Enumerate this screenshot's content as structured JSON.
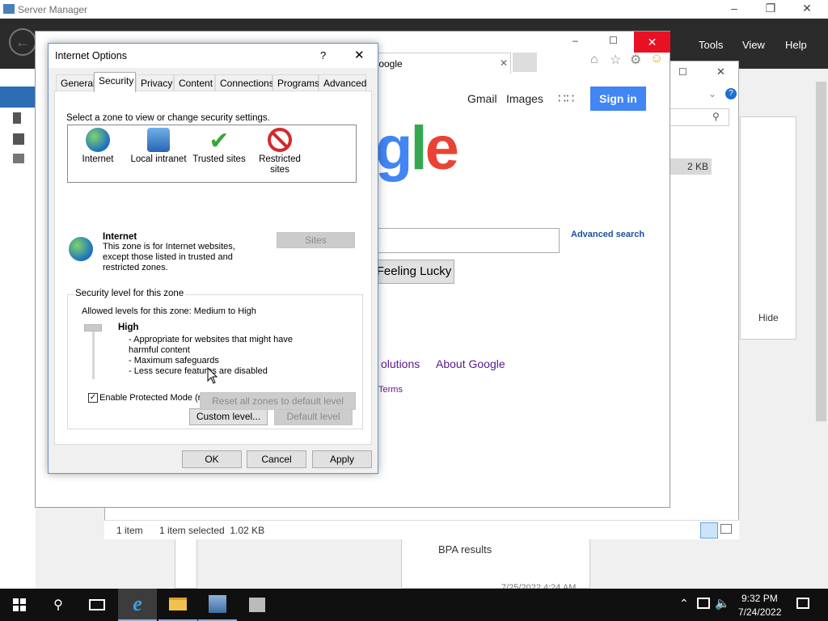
{
  "server_manager": {
    "title": "Server Manager",
    "menu": [
      "Tools",
      "View",
      "Help"
    ],
    "bpa": "BPA results",
    "date": "7/25/2022 4:24 AM"
  },
  "explorer": {
    "item_count": "1 item",
    "selection": "1 item selected  1.02 KB",
    "file_size": "2 KB",
    "hide": "Hide"
  },
  "ie": {
    "tab_title": "Google",
    "google": {
      "links": [
        "Gmail",
        "Images"
      ],
      "sign_in": "Sign in",
      "advanced_search": "Advanced search",
      "lucky": "Feeling Lucky",
      "footer": [
        "olutions",
        "About Google"
      ],
      "terms": "Terms"
    }
  },
  "dialog": {
    "title": "Internet Options",
    "help": "?",
    "tabs": [
      "General",
      "Security",
      "Privacy",
      "Content",
      "Connections",
      "Programs",
      "Advanced"
    ],
    "zone_prompt": "Select a zone to view or change security settings.",
    "zones": [
      {
        "label": "Internet"
      },
      {
        "label": "Local intranet"
      },
      {
        "label": "Trusted sites"
      },
      {
        "label": "Restricted sites"
      }
    ],
    "zone_name": "Internet",
    "zone_desc": "This zone is for Internet websites, except those listed in trusted and restricted zones.",
    "sites": "Sites",
    "security_group": "Security level for this zone",
    "allowed": "Allowed levels for this zone: Medium to High",
    "level": "High",
    "bullets": [
      "- Appropriate for websites that might have harmful content",
      "- Maximum safeguards",
      "- Less secure features are disabled"
    ],
    "protected_mode": "Enable Protected Mode (requires restarting Internet Explorer)",
    "custom_level": "Custom level...",
    "default_level": "Default level",
    "reset_all": "Reset all zones to default level",
    "ok": "OK",
    "cancel": "Cancel",
    "apply": "Apply"
  },
  "taskbar": {
    "time": "9:32 PM",
    "date": "7/24/2022"
  }
}
